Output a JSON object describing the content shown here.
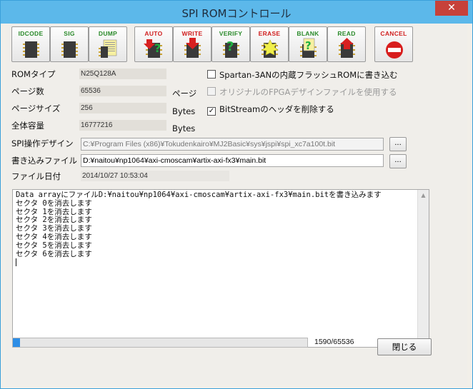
{
  "window": {
    "title": "SPI ROMコントロール",
    "close_glyph": "✕"
  },
  "toolbar": [
    {
      "label": "IDCODE",
      "color": "#2a8a2a",
      "icon": "chip-icon"
    },
    {
      "label": "SIG",
      "color": "#2a8a2a",
      "icon": "chip-icon"
    },
    {
      "label": "DUMP",
      "color": "#2a8a2a",
      "icon": "dump-chip-icon"
    },
    {
      "label": "AUTO",
      "color": "#d02020",
      "icon": "auto-chip-icon"
    },
    {
      "label": "WRITE",
      "color": "#d02020",
      "icon": "write-chip-icon"
    },
    {
      "label": "VERIFY",
      "color": "#2a8a2a",
      "icon": "verify-chip-icon"
    },
    {
      "label": "ERASE",
      "color": "#d02020",
      "icon": "erase-chip-icon"
    },
    {
      "label": "BLANK",
      "color": "#2a8a2a",
      "icon": "blank-chip-icon"
    },
    {
      "label": "READ",
      "color": "#2a8a2a",
      "icon": "read-chip-icon"
    },
    {
      "label": "CANCEL",
      "color": "#d02020",
      "icon": "cancel-icon"
    }
  ],
  "info": {
    "rom_type_label": "ROMタイプ",
    "rom_type": "N25Q128A",
    "pages_label": "ページ数",
    "pages": "65536",
    "pages_unit": "ページ",
    "page_size_label": "ページサイズ",
    "page_size": "256",
    "page_size_unit": "Bytes",
    "capacity_label": "全体容量",
    "capacity": "16777216",
    "capacity_unit": "Bytes"
  },
  "options": {
    "spartan": {
      "label": "Spartan-3ANの内蔵フラッシュROMに書き込む",
      "checked": false,
      "disabled": false
    },
    "original_fpga": {
      "label": "オリジナルのFPGAデザインファイルを使用する",
      "checked": false,
      "disabled": true
    },
    "remove_header": {
      "label": "BitStreamのヘッダを削除する",
      "checked": true,
      "disabled": false
    }
  },
  "files": {
    "spi_design_label": "SPI操作デザイン",
    "spi_design": "C:¥Program Files (x86)¥Tokudenkairo¥MJ2Basic¥sys¥jspi¥spi_xc7a100t.bit",
    "write_file_label": "書き込みファイル",
    "write_file": "D:¥naitou¥np1064¥axi-cmoscam¥artix-axi-fx3¥main.bit",
    "file_date_label": "ファイル日付",
    "file_date": "2014/10/27 10:53:04",
    "browse_label": "..."
  },
  "log": [
    "Data arrayにファイルD:¥naitou¥np1064¥axi-cmoscam¥artix-axi-fx3¥main.bitを書き込みます",
    "セクタ 0を消去します",
    "セクタ 1を消去します",
    "セクタ 2を消去します",
    "セクタ 3を消去します",
    "セクタ 4を消去します",
    "セクタ 5を消去します",
    "セクタ 6を消去します"
  ],
  "progress": {
    "current": 1590,
    "total": 65536,
    "text": "1590/65536"
  },
  "close_button": "閉じる",
  "colors": {
    "titlebar": "#5cb8ea",
    "progress": "#2e8ee6",
    "close": "#c7413a"
  }
}
